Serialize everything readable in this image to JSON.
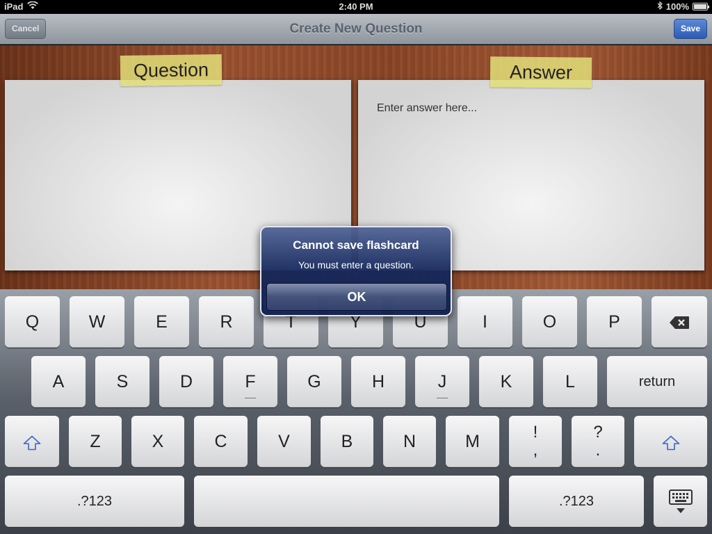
{
  "status_bar": {
    "device": "iPad",
    "time": "2:40 PM",
    "battery": "100%"
  },
  "nav": {
    "title": "Create New Question",
    "cancel_label": "Cancel",
    "save_label": "Save"
  },
  "cards": {
    "question_label": "Question",
    "answer_label": "Answer",
    "answer_placeholder": "Enter answer here..."
  },
  "alert": {
    "title": "Cannot save flashcard",
    "message": "You must enter a question.",
    "ok_label": "OK"
  },
  "keyboard": {
    "row1": [
      "Q",
      "W",
      "E",
      "R",
      "T",
      "Y",
      "U",
      "I",
      "O",
      "P"
    ],
    "row2": [
      "A",
      "S",
      "D",
      "F",
      "G",
      "H",
      "J",
      "K",
      "L"
    ],
    "return_label": "return",
    "row3": [
      "Z",
      "X",
      "C",
      "V",
      "B",
      "N",
      "M"
    ],
    "punct1_top": "!",
    "punct1_bottom": ",",
    "punct2_top": "?",
    "punct2_bottom": ".",
    "numbers_label": ".?123"
  },
  "colors": {
    "save_accent": "#2c5bb5",
    "alert_bg": "#162a5c",
    "tape": "#e2de78",
    "shift_arrow": "#3b63c9"
  }
}
